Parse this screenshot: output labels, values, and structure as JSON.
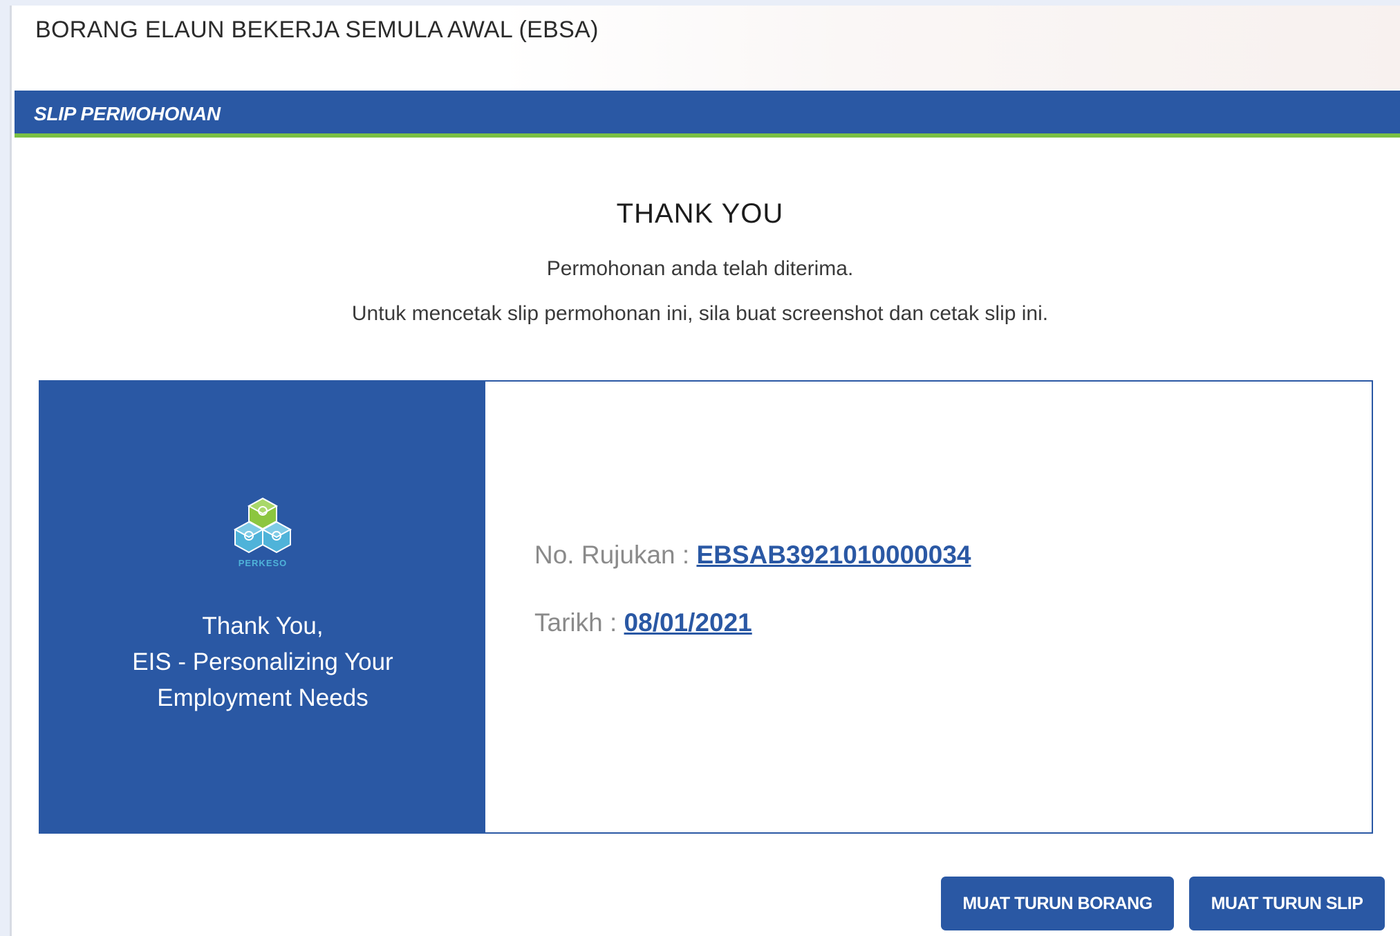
{
  "header": {
    "form_title": "BORANG ELAUN BEKERJA SEMULA AWAL (EBSA)"
  },
  "section": {
    "title": "SLIP PERMOHONAN"
  },
  "confirmation": {
    "heading": "THANK YOU",
    "message_received": "Permohonan anda telah diterima.",
    "message_print": "Untuk mencetak slip permohonan ini, sila buat screenshot dan cetak slip ini."
  },
  "slip": {
    "logo": {
      "icon": "perkeso-logo-icon",
      "text": "PERKESO"
    },
    "thanks_line1": "Thank You,",
    "thanks_line2": "EIS - Personalizing Your",
    "thanks_line3": "Employment Needs",
    "reference_label": "No. Rujukan :",
    "reference_value": "EBSAB3921010000034",
    "date_label": "Tarikh :",
    "date_value": "08/01/2021"
  },
  "actions": {
    "download_form_label": "MUAT TURUN BORANG",
    "download_slip_label": "MUAT TURUN SLIP"
  },
  "colors": {
    "primary": "#2a58a4",
    "accent_green": "#7ac043",
    "logo_green": "#8cc63f",
    "logo_blue": "#4fb3d9"
  }
}
